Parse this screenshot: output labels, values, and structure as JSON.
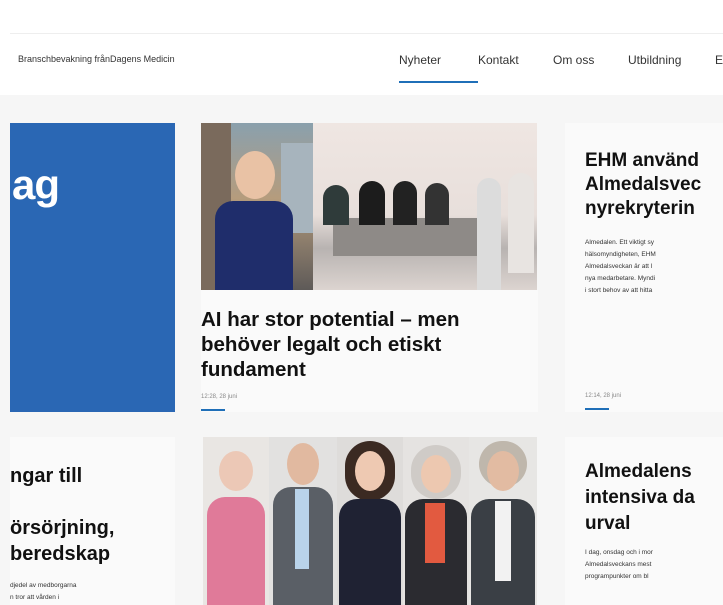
{
  "nav": {
    "brand": "Branschbevakning frånDagens Medicin",
    "items": [
      {
        "label": "Nyheter",
        "active": true
      },
      {
        "label": "Kontakt",
        "active": false
      },
      {
        "label": "Om oss",
        "active": false
      },
      {
        "label": "Utbildning",
        "active": false
      },
      {
        "label": "E",
        "active": false
      }
    ]
  },
  "cards": {
    "blue_panel_text": "ag",
    "feature": {
      "headline": "AI har stor potential – men behöver legalt och etiskt fundament",
      "time": "12:28, 28 juni"
    },
    "right_top": {
      "headline": "EHM använd\nAlmedalsvec\nnyrekryterin",
      "body": "Almedalen. Ett viktigt sy\nhälsomyndigheten, EHM\nAlmedalsveckan är att l\nnya medarbetare. Myndi\ni stort behov av att hitta",
      "time": "12:14, 28 juni"
    },
    "left_bottom": {
      "line1": "ngar till",
      "line2": "örsörjning,\n beredskap",
      "body": "djedel av medborgarna\nn tror att vården i"
    },
    "right_bottom": {
      "headline": "Almedalens\nintensiva da\nurval",
      "body": "I dag, onsdag och i mor\nAlmedalsveckans mest\nprogrampunkter om bl"
    }
  },
  "colors": {
    "accent": "#1f6fb8",
    "blue_panel": "#2a67b4"
  }
}
